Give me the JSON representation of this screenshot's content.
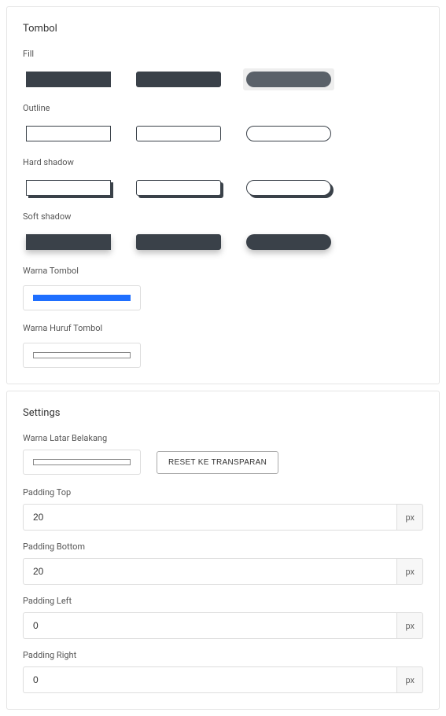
{
  "tombol_panel": {
    "title": "Tombol",
    "groups": {
      "fill": "Fill",
      "outline": "Outline",
      "hard_shadow": "Hard shadow",
      "soft_shadow": "Soft shadow"
    },
    "warna_tombol_label": "Warna Tombol",
    "warna_huruf_label": "Warna Huruf Tombol",
    "colors": {
      "button_color": "#1f6fff",
      "text_color": "#ffffff"
    }
  },
  "settings_panel": {
    "title": "Settings",
    "warna_latar_label": "Warna Latar Belakang",
    "reset_button": "RESET KE TRANSPARAN",
    "background_color": "#ffffff",
    "padding_top_label": "Padding Top",
    "padding_bottom_label": "Padding Bottom",
    "padding_left_label": "Padding Left",
    "padding_right_label": "Padding Right",
    "unit": "px",
    "values": {
      "padding_top": "20",
      "padding_bottom": "20",
      "padding_left": "0",
      "padding_right": "0"
    }
  }
}
